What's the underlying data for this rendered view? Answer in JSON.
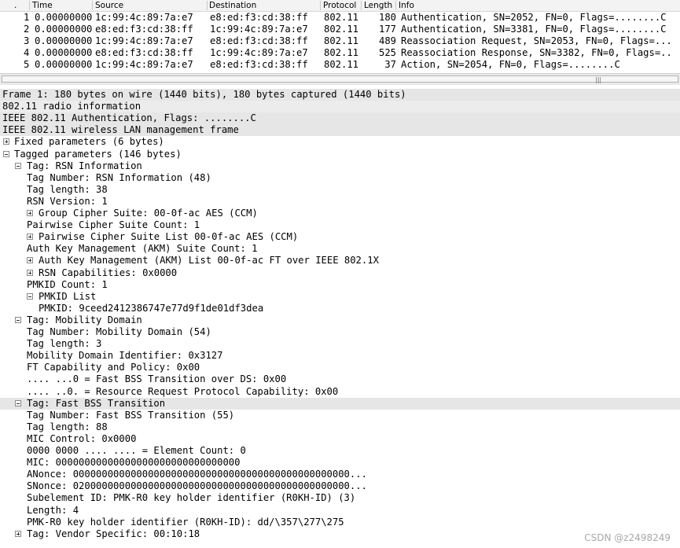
{
  "packet_list": {
    "columns": {
      "no": ".",
      "time": "Time",
      "source": "Source",
      "destination": "Destination",
      "protocol": "Protocol",
      "length": "Length",
      "info": "Info"
    },
    "rows": [
      {
        "no": "1",
        "time": "0.00000000",
        "source": "1c:99:4c:89:7a:e7",
        "destination": "e8:ed:f3:cd:38:ff",
        "protocol": "802.11",
        "length": "180",
        "info": "Authentication, SN=2052, FN=0, Flags=........C"
      },
      {
        "no": "2",
        "time": "0.00000000",
        "source": "e8:ed:f3:cd:38:ff",
        "destination": "1c:99:4c:89:7a:e7",
        "protocol": "802.11",
        "length": "177",
        "info": "Authentication, SN=3381, FN=0, Flags=........C"
      },
      {
        "no": "3",
        "time": "0.00000000",
        "source": "1c:99:4c:89:7a:e7",
        "destination": "e8:ed:f3:cd:38:ff",
        "protocol": "802.11",
        "length": "489",
        "info": "Reassociation Request, SN=2053, FN=0, Flags=..."
      },
      {
        "no": "4",
        "time": "0.00000000",
        "source": "e8:ed:f3:cd:38:ff",
        "destination": "1c:99:4c:89:7a:e7",
        "protocol": "802.11",
        "length": "525",
        "info": "Reassociation Response, SN=3382, FN=0, Flags=.."
      },
      {
        "no": "5",
        "time": "0.00000000",
        "source": "1c:99:4c:89:7a:e7",
        "destination": "e8:ed:f3:cd:38:ff",
        "protocol": "802.11",
        "length": "37",
        "info": "Action, SN=2054, FN=0, Flags=........C"
      }
    ]
  },
  "scrollbar": {
    "grip": "|||"
  },
  "details": [
    {
      "text": "Frame 1: 180 bytes on wire (1440 bits), 180 bytes captured (1440 bits)",
      "toggle": "",
      "level": 0,
      "hl": 1
    },
    {
      "text": "802.11 radio information",
      "toggle": "",
      "level": 0,
      "hl": 2
    },
    {
      "text": "IEEE 802.11 Authentication, Flags: ........C",
      "toggle": "",
      "level": 0,
      "hl": 1
    },
    {
      "text": "IEEE 802.11 wireless LAN management frame",
      "toggle": "",
      "level": 0,
      "hl": 1
    },
    {
      "text": "Fixed parameters (6 bytes)",
      "toggle": "plus",
      "level": 0,
      "hl": 0
    },
    {
      "text": "Tagged parameters (146 bytes)",
      "toggle": "minus",
      "level": 0,
      "hl": 0
    },
    {
      "text": "Tag: RSN Information",
      "toggle": "minus",
      "level": 1,
      "hl": 0
    },
    {
      "text": "Tag Number: RSN Information (48)",
      "toggle": "",
      "level": 2,
      "hl": 0
    },
    {
      "text": "Tag length: 38",
      "toggle": "",
      "level": 2,
      "hl": 0
    },
    {
      "text": "RSN Version: 1",
      "toggle": "",
      "level": 2,
      "hl": 0
    },
    {
      "text": "Group Cipher Suite: 00-0f-ac AES (CCM)",
      "toggle": "plus",
      "level": 2,
      "hl": 0
    },
    {
      "text": "Pairwise Cipher Suite Count: 1",
      "toggle": "",
      "level": 2,
      "hl": 0
    },
    {
      "text": "Pairwise Cipher Suite List 00-0f-ac AES (CCM)",
      "toggle": "plus",
      "level": 2,
      "hl": 0
    },
    {
      "text": "Auth Key Management (AKM) Suite Count: 1",
      "toggle": "",
      "level": 2,
      "hl": 0
    },
    {
      "text": "Auth Key Management (AKM) List 00-0f-ac FT over IEEE 802.1X",
      "toggle": "plus",
      "level": 2,
      "hl": 0
    },
    {
      "text": "RSN Capabilities: 0x0000",
      "toggle": "plus",
      "level": 2,
      "hl": 0
    },
    {
      "text": "PMKID Count: 1",
      "toggle": "",
      "level": 2,
      "hl": 0
    },
    {
      "text": "PMKID List",
      "toggle": "minus",
      "level": 2,
      "hl": 0
    },
    {
      "text": "PMKID: 9ceed2412386747e77d9f1de01df3dea",
      "toggle": "",
      "level": 3,
      "hl": 0
    },
    {
      "text": "Tag: Mobility Domain",
      "toggle": "minus",
      "level": 1,
      "hl": 0
    },
    {
      "text": "Tag Number: Mobility Domain (54)",
      "toggle": "",
      "level": 2,
      "hl": 0
    },
    {
      "text": "Tag length: 3",
      "toggle": "",
      "level": 2,
      "hl": 0
    },
    {
      "text": "Mobility Domain Identifier: 0x3127",
      "toggle": "",
      "level": 2,
      "hl": 0
    },
    {
      "text": "FT Capability and Policy: 0x00",
      "toggle": "",
      "level": 2,
      "hl": 0
    },
    {
      "text": ".... ...0 = Fast BSS Transition over DS: 0x00",
      "toggle": "",
      "level": 2,
      "hl": 0
    },
    {
      "text": ".... ..0. = Resource Request Protocol Capability: 0x00",
      "toggle": "",
      "level": 2,
      "hl": 0
    },
    {
      "text": "Tag: Fast BSS Transition",
      "toggle": "minus",
      "level": 1,
      "hl": 1
    },
    {
      "text": "Tag Number: Fast BSS Transition (55)",
      "toggle": "",
      "level": 2,
      "hl": 0
    },
    {
      "text": "Tag length: 88",
      "toggle": "",
      "level": 2,
      "hl": 0
    },
    {
      "text": "MIC Control: 0x0000",
      "toggle": "",
      "level": 2,
      "hl": 0
    },
    {
      "text": "0000 0000 .... .... = Element Count: 0",
      "toggle": "",
      "level": 2,
      "hl": 0
    },
    {
      "text": "MIC: 00000000000000000000000000000000",
      "toggle": "",
      "level": 2,
      "hl": 0
    },
    {
      "text": "ANonce: 000000000000000000000000000000000000000000000000...",
      "toggle": "",
      "level": 2,
      "hl": 0
    },
    {
      "text": "SNonce: 020000000000000000000000000000000000000000000000...",
      "toggle": "",
      "level": 2,
      "hl": 0
    },
    {
      "text": "Subelement ID: PMK-R0 key holder identifier (R0KH-ID) (3)",
      "toggle": "",
      "level": 2,
      "hl": 0
    },
    {
      "text": "Length: 4",
      "toggle": "",
      "level": 2,
      "hl": 0
    },
    {
      "text": "PMK-R0 key holder identifier (R0KH-ID): dd/\\357\\277\\275",
      "toggle": "",
      "level": 2,
      "hl": 0
    },
    {
      "text": "Tag: Vendor Specific: 00:10:18",
      "toggle": "plus",
      "level": 1,
      "hl": 0
    }
  ],
  "watermark": "CSDN @z2498249"
}
